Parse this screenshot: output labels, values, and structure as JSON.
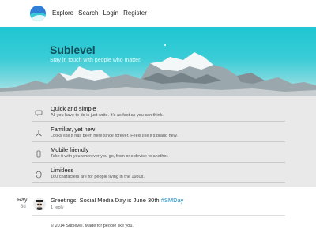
{
  "nav": {
    "links": [
      "Explore",
      "Search",
      "Login",
      "Register"
    ]
  },
  "hero": {
    "title": "Sublevel",
    "tagline": "Stay in touch with people who matter."
  },
  "features": [
    {
      "icon": "chat-bubble-icon",
      "title": "Quick and simple",
      "desc": "All you have to do is just write. It's as fast as you can think."
    },
    {
      "icon": "share-icon",
      "title": "Familiar, yet new",
      "desc": "Looks like it has been here since forever. Feels like it's brand new."
    },
    {
      "icon": "phone-icon",
      "title": "Mobile friendly",
      "desc": "Take it with you wherever you go, from one device to another."
    },
    {
      "icon": "repeat-icon",
      "title": "Limitless",
      "desc": "160 characters are for people living in the 1980s."
    }
  ],
  "post": {
    "user": "Ray",
    "time": "3d",
    "text": "Greetings! Social Media Day is June 30th ",
    "hashtag": "#SMDay",
    "replies": "1 reply"
  },
  "footer": {
    "text": "© 2014 Sublevel. Made for people like you."
  },
  "colors": {
    "hero_top": "#1ec6d2",
    "hero_title": "#0f4f5a",
    "feature_bg": "#e9e9e9",
    "link": "#1a8dbf"
  }
}
